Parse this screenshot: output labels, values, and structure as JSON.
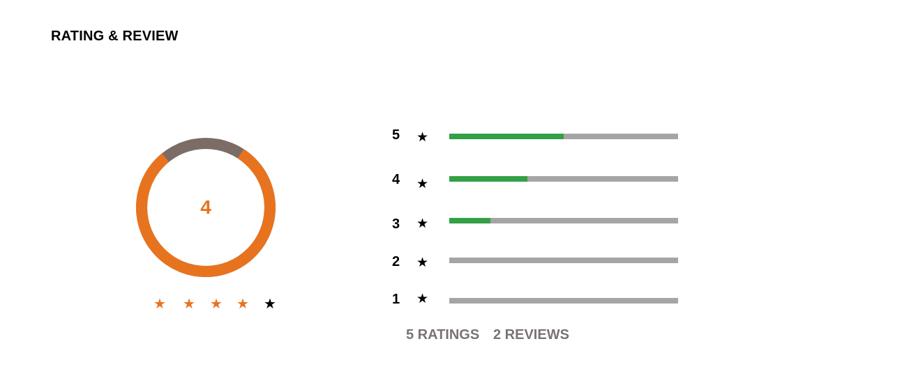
{
  "header": {
    "title": "RATING & REVIEW"
  },
  "overall": {
    "rating": "4",
    "fill_fraction": 0.8,
    "filled_color": "#e8731f",
    "empty_color": "#7b6d66"
  },
  "stars": {
    "icon": "star-icon",
    "glyph": "★",
    "filled_count": 4,
    "total": 5,
    "filled_color": "#e8731f",
    "empty_color": "#000000"
  },
  "breakdown": {
    "star_glyph": "★",
    "bar_fill_color": "#33a046",
    "bar_track_color": "#a7a4a5",
    "rows": [
      {
        "label": "5",
        "fraction": 0.5
      },
      {
        "label": "4",
        "fraction": 0.34
      },
      {
        "label": "3",
        "fraction": 0.18
      },
      {
        "label": "2",
        "fraction": 0
      },
      {
        "label": "1",
        "fraction": 0
      }
    ]
  },
  "summary": {
    "ratings": "5 RATINGS",
    "reviews": "2 REVIEWS"
  }
}
